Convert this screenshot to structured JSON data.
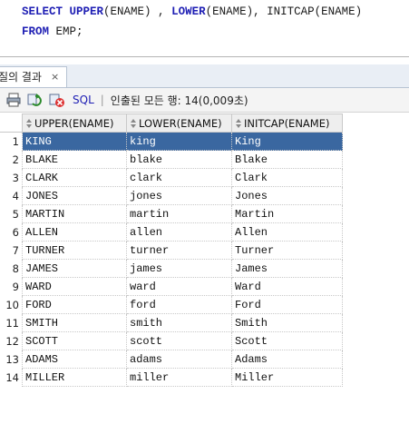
{
  "editor": {
    "line1": {
      "kw1": "SELECT",
      "fn1": "UPPER",
      "rest1": "(ENAME) , ",
      "fn2": "LOWER",
      "rest2": "(ENAME), INITCAP(ENAME)"
    },
    "line2": {
      "kw1": "FROM",
      "rest": " EMP;"
    }
  },
  "tab": {
    "label": "질의 결과",
    "close": "×"
  },
  "toolbar": {
    "sql_label": "SQL",
    "separator": "|",
    "status": "인출된 모든 행: 14(0,009초)"
  },
  "grid": {
    "columns": [
      "UPPER(ENAME)",
      "LOWER(ENAME)",
      "INITCAP(ENAME)"
    ],
    "rows": [
      {
        "n": "1",
        "c": [
          "KING",
          "king",
          "King"
        ]
      },
      {
        "n": "2",
        "c": [
          "BLAKE",
          "blake",
          "Blake"
        ]
      },
      {
        "n": "3",
        "c": [
          "CLARK",
          "clark",
          "Clark"
        ]
      },
      {
        "n": "4",
        "c": [
          "JONES",
          "jones",
          "Jones"
        ]
      },
      {
        "n": "5",
        "c": [
          "MARTIN",
          "martin",
          "Martin"
        ]
      },
      {
        "n": "6",
        "c": [
          "ALLEN",
          "allen",
          "Allen"
        ]
      },
      {
        "n": "7",
        "c": [
          "TURNER",
          "turner",
          "Turner"
        ]
      },
      {
        "n": "8",
        "c": [
          "JAMES",
          "james",
          "James"
        ]
      },
      {
        "n": "9",
        "c": [
          "WARD",
          "ward",
          "Ward"
        ]
      },
      {
        "n": "10",
        "c": [
          "FORD",
          "ford",
          "Ford"
        ]
      },
      {
        "n": "11",
        "c": [
          "SMITH",
          "smith",
          "Smith"
        ]
      },
      {
        "n": "12",
        "c": [
          "SCOTT",
          "scott",
          "Scott"
        ]
      },
      {
        "n": "13",
        "c": [
          "ADAMS",
          "adams",
          "Adams"
        ]
      },
      {
        "n": "14",
        "c": [
          "MILLER",
          "miller",
          "Miller"
        ]
      }
    ],
    "selected_row": 1
  },
  "icons": {
    "print": "print-icon",
    "refresh": "refresh-icon",
    "cancel": "cancel-icon",
    "sort": "sort-icon"
  }
}
